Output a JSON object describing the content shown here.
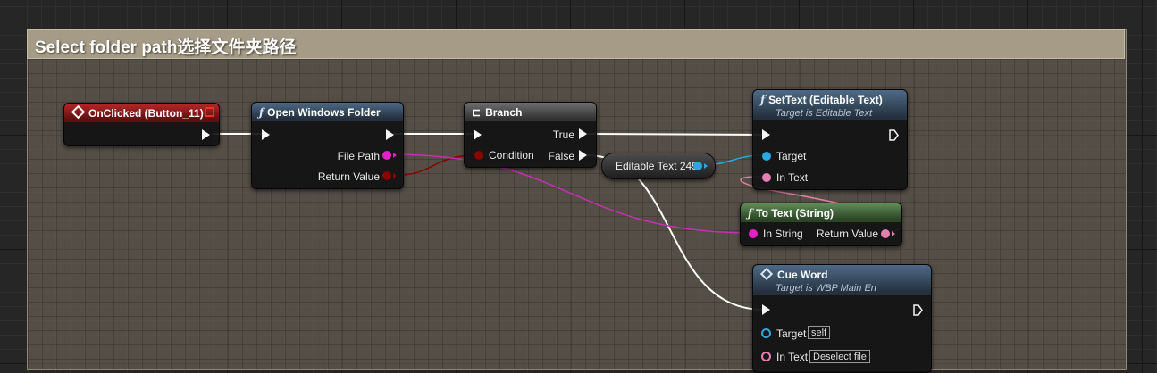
{
  "comment": {
    "title": "Select folder path选择文件夹路径"
  },
  "colors": {
    "exec": "#f4f4f4",
    "event_header": "#b82828",
    "function_header": "#4e6a86",
    "pure_header": "#5f8e56",
    "bool_pin": "#8b0000",
    "string_pin": "#e81fc3",
    "text_pin": "#e67fb0",
    "object_pin": "#2aa9e0",
    "comment_header": "#a59b87"
  },
  "nodes": {
    "onclicked": {
      "title": "OnClicked (Button_11)",
      "icon": "event-icon"
    },
    "open_folder": {
      "title": "Open Windows Folder",
      "icon": "function-icon",
      "pin_file_path": "File Path",
      "pin_return": "Return Value"
    },
    "branch": {
      "title": "Branch",
      "icon": "branch-icon",
      "pin_condition": "Condition",
      "pin_true": "True",
      "pin_false": "False"
    },
    "settext": {
      "title": "SetText (Editable Text)",
      "subtitle": "Target is Editable Text",
      "icon": "function-icon",
      "pin_target": "Target",
      "pin_intext": "In Text"
    },
    "editable_var": {
      "label": "Editable Text 249"
    },
    "totext": {
      "title": "To Text (String)",
      "icon": "function-icon",
      "pin_in": "In String",
      "pin_return": "Return Value"
    },
    "cueword": {
      "title": "Cue Word",
      "subtitle": "Target is WBP Main En",
      "icon": "function-icon",
      "pin_target": "Target",
      "target_default": "self",
      "pin_intext": "In Text",
      "intext_default": "Deselect file"
    }
  }
}
